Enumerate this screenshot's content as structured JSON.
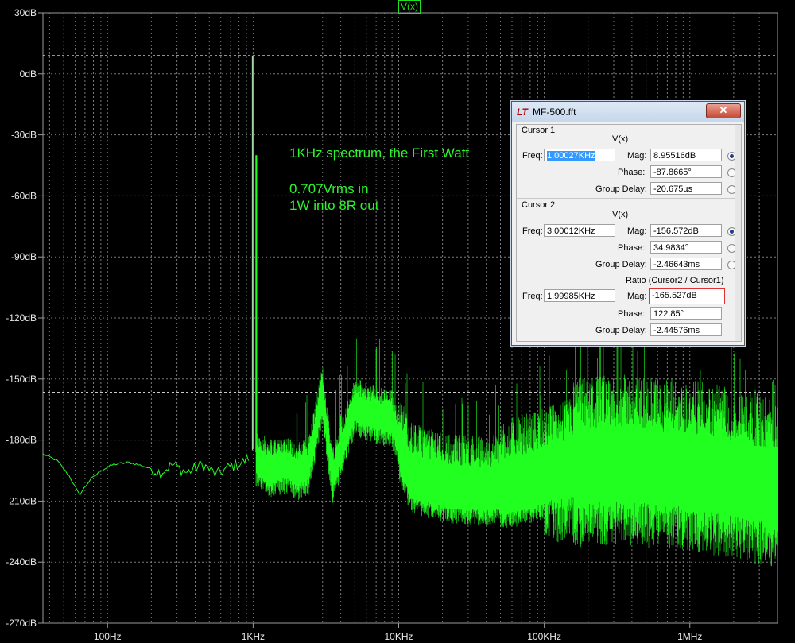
{
  "trace": {
    "label": "V(x)",
    "color": "#20ff20"
  },
  "annotations": [
    "1KHz spectrum, the First Watt",
    "0.707Vrms in",
    "1W into 8R out"
  ],
  "chart_data": {
    "type": "line",
    "series_name": "V(x)",
    "xscale": "log",
    "xlim": [
      36,
      4000000
    ],
    "ylim": [
      -270,
      30
    ],
    "ylabel_unit": "dB",
    "grid": true,
    "y_ticks": [
      "30dB",
      "0dB",
      "-30dB",
      "-60dB",
      "-90dB",
      "-120dB",
      "-150dB",
      "-180dB",
      "-210dB",
      "-240dB",
      "-270dB"
    ],
    "y_tick_values": [
      30,
      0,
      -30,
      -60,
      -90,
      -120,
      -150,
      -180,
      -210,
      -240,
      -270
    ],
    "x_ticks": [
      "100Hz",
      "1KHz",
      "10KHz",
      "100KHz",
      "1MHz"
    ],
    "x_tick_values": [
      100,
      1000,
      10000,
      100000,
      1000000
    ],
    "cursor_levels_db": [
      8.955,
      -156.572
    ],
    "points": [
      [
        36,
        -187
      ],
      [
        45,
        -190
      ],
      [
        55,
        -198
      ],
      [
        64,
        -207
      ],
      [
        75,
        -200
      ],
      [
        90,
        -195
      ],
      [
        110,
        -192
      ],
      [
        140,
        -191
      ],
      [
        180,
        -193
      ],
      [
        230,
        -196
      ],
      [
        280,
        -192
      ],
      [
        350,
        -196
      ],
      [
        450,
        -192
      ],
      [
        560,
        -197
      ],
      [
        700,
        -193
      ],
      [
        850,
        -191
      ],
      [
        950,
        -188
      ],
      [
        1000,
        8.955
      ],
      [
        1050,
        -189
      ],
      [
        1300,
        -193
      ],
      [
        1700,
        -191
      ],
      [
        2000,
        -195
      ],
      [
        2400,
        -192
      ],
      [
        3000,
        -156.6
      ],
      [
        3500,
        -197
      ],
      [
        5000,
        -163
      ],
      [
        7000,
        -167
      ],
      [
        9000,
        -169
      ],
      [
        12000,
        -195
      ],
      [
        20000,
        -200
      ],
      [
        40000,
        -202
      ],
      [
        80000,
        -197
      ],
      [
        150000,
        -190
      ],
      [
        300000,
        -188
      ],
      [
        600000,
        -190
      ],
      [
        1200000,
        -192
      ],
      [
        2000000,
        -195
      ],
      [
        4000000,
        -200
      ]
    ],
    "harmonics": [
      {
        "x": 1000,
        "y": 8.955
      },
      {
        "x": 2000,
        "y": -167
      },
      {
        "x": 3000,
        "y": -156.6
      },
      {
        "x": 4000,
        "y": -168
      },
      {
        "x": 5000,
        "y": -163
      },
      {
        "x": 6000,
        "y": -170
      },
      {
        "x": 7000,
        "y": -167
      },
      {
        "x": 8000,
        "y": -173
      },
      {
        "x": 9000,
        "y": -169
      },
      {
        "x": 11000,
        "y": -172
      },
      {
        "x": 13000,
        "y": -173
      },
      {
        "x": 15000,
        "y": -176
      },
      {
        "x": 17000,
        "y": -177
      },
      {
        "x": 19000,
        "y": -178
      }
    ]
  },
  "dialog": {
    "title": "MF-500.fft",
    "close_glyph": "✕",
    "logo": "LT",
    "cursor1": {
      "heading": "Cursor 1",
      "trace": "V(x)",
      "freq_label": "Freq:",
      "freq": "1.00027KHz",
      "mag_label": "Mag:",
      "mag": "8.95516dB",
      "phase_label": "Phase:",
      "phase": "-87.8665°",
      "gd_label": "Group Delay:",
      "gd": "-20.675µs"
    },
    "cursor2": {
      "heading": "Cursor 2",
      "trace": "V(x)",
      "freq_label": "Freq:",
      "freq": "3.00012KHz",
      "mag_label": "Mag:",
      "mag": "-156.572dB",
      "phase_label": "Phase:",
      "phase": "34.9834°",
      "gd_label": "Group Delay:",
      "gd": "-2.46643ms"
    },
    "ratio": {
      "heading": "Ratio (Cursor2 / Cursor1)",
      "freq_label": "Freq:",
      "freq": "1.99985KHz",
      "mag_label": "Mag:",
      "mag": "-165.527dB",
      "phase_label": "Phase:",
      "phase": "122.85°",
      "gd_label": "Group Delay:",
      "gd": "-2.44576ms"
    }
  }
}
